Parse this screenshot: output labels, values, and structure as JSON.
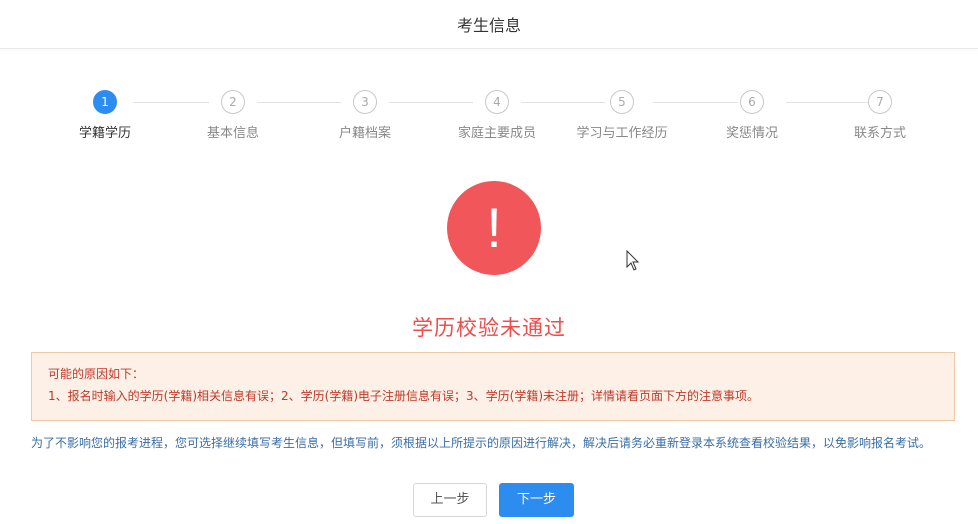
{
  "header": {
    "title": "考生信息"
  },
  "steps": [
    {
      "num": "1",
      "label": "学籍学历",
      "active": true
    },
    {
      "num": "2",
      "label": "基本信息",
      "active": false
    },
    {
      "num": "3",
      "label": "户籍档案",
      "active": false
    },
    {
      "num": "4",
      "label": "家庭主要成员",
      "active": false
    },
    {
      "num": "5",
      "label": "学习与工作经历",
      "active": false
    },
    {
      "num": "6",
      "label": "奖惩情况",
      "active": false
    },
    {
      "num": "7",
      "label": "联系方式",
      "active": false
    }
  ],
  "result": {
    "icon": "exclamation-icon",
    "icon_glyph": "!",
    "title": "学历校验未通过"
  },
  "reason": {
    "heading": "可能的原因如下：",
    "text": "1、报名时输入的学历(学籍)相关信息有误；2、学历(学籍)电子注册信息有误；3、学历(学籍)未注册；详情请看页面下方的注意事项。"
  },
  "notice": {
    "text": "为了不影响您的报考进程，您可选择继续填写考生信息，但填写前，须根据以上所提示的原因进行解决，解决后请务必重新登录本系统查看校验结果，以免影响报名考试。"
  },
  "buttons": {
    "prev": "上一步",
    "next": "下一步"
  },
  "colors": {
    "primary": "#2d8cf0",
    "error": "#f0565a",
    "warning_bg": "#fdf0e6",
    "warning_border": "#f2c9a6"
  }
}
